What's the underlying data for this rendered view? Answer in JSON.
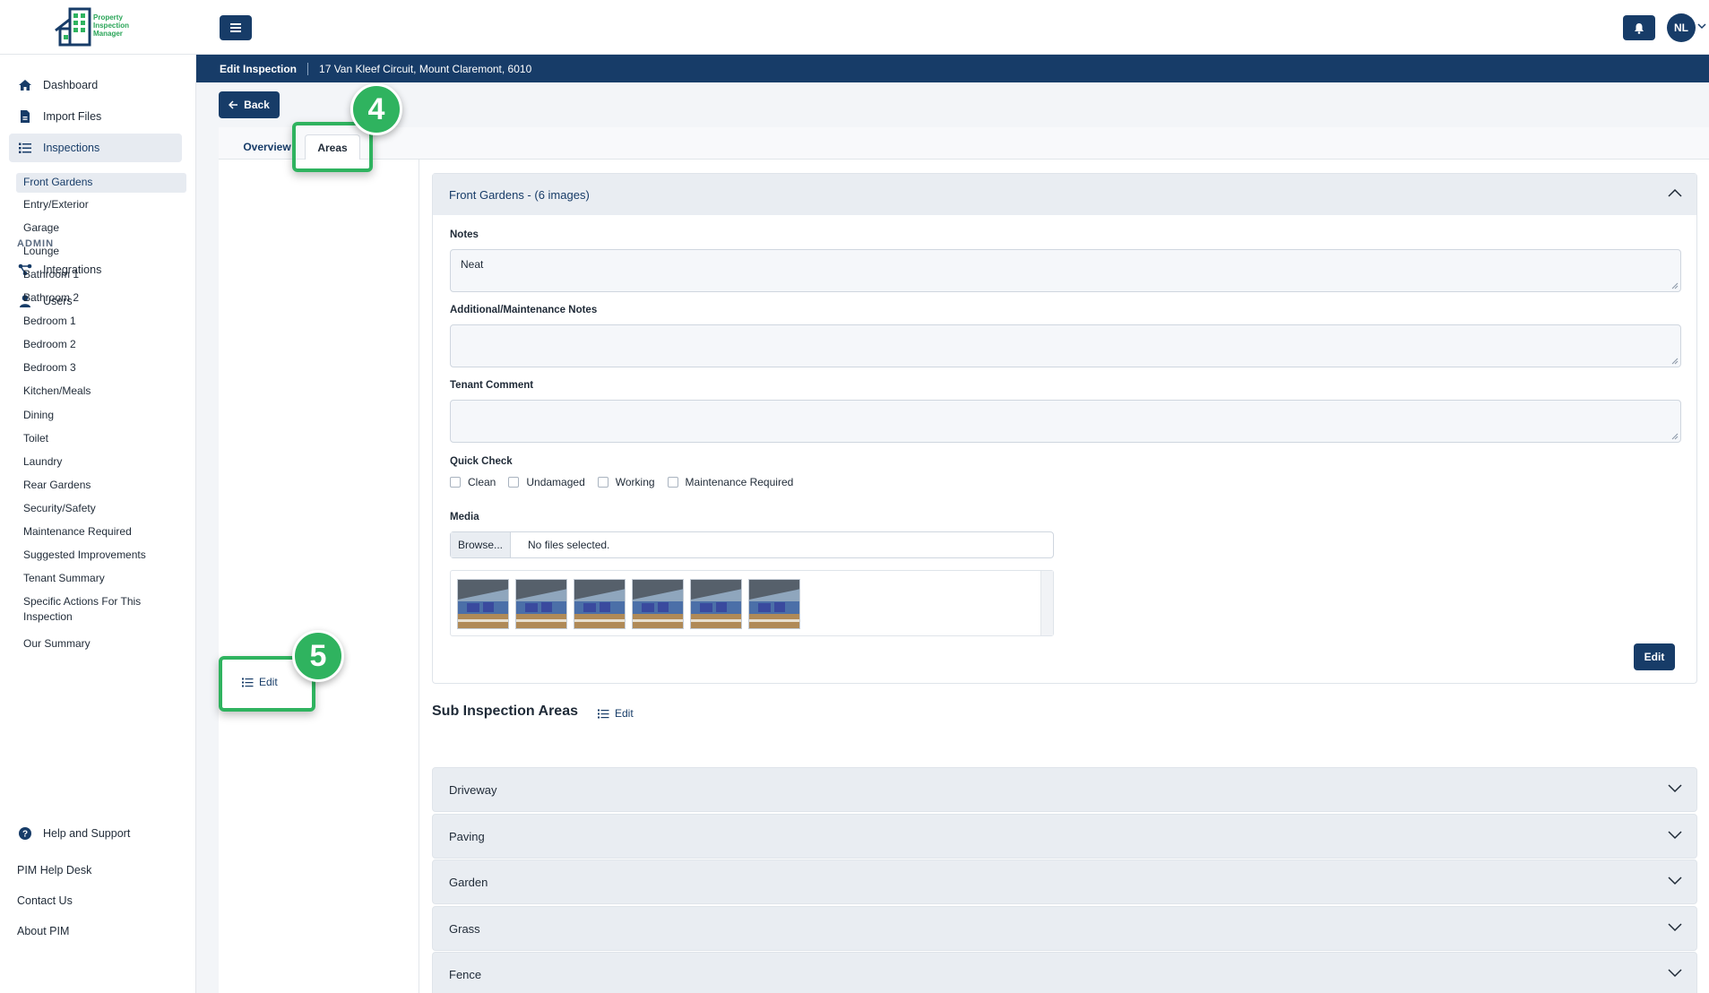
{
  "brand": {
    "name_line1": "Property",
    "name_line2": "Inspection",
    "name_line3": "Manager"
  },
  "user": {
    "initials": "NL"
  },
  "sidebar": {
    "items": [
      {
        "label": "Dashboard",
        "icon": "home-icon"
      },
      {
        "label": "Import Files",
        "icon": "file-icon"
      },
      {
        "label": "Inspections",
        "icon": "list-icon",
        "active": true
      }
    ],
    "admin_label": "ADMIN",
    "admin_items": [
      {
        "label": "Integrations",
        "icon": "integrations-icon"
      },
      {
        "label": "Users",
        "icon": "user-icon"
      }
    ],
    "footer": {
      "help": "Help and Support",
      "helpdesk": "PIM Help Desk",
      "contact": "Contact Us",
      "about": "About PIM"
    }
  },
  "header": {
    "title": "Edit Inspection",
    "address": "17 Van Kleef Circuit, Mount Claremont, 6010"
  },
  "back_label": "Back",
  "tabs": {
    "overview": "Overview",
    "areas": "Areas"
  },
  "badges": {
    "areas_tab": "4",
    "areas_edit": "5"
  },
  "areas": [
    "Front Gardens",
    "Entry/Exterior",
    "Garage",
    "Lounge",
    "Bathroom 1",
    "Bathroom 2",
    "Bedroom 1",
    "Bedroom 2",
    "Bedroom 3",
    "Kitchen/Meals",
    "Dining",
    "Toilet",
    "Laundry",
    "Rear Gardens",
    "Security/Safety",
    "Maintenance Required",
    "Suggested Improvements",
    "Tenant Summary",
    "Specific Actions For This Inspection",
    "Our Summary"
  ],
  "areas_edit_label": "Edit",
  "card": {
    "title": "Front Gardens - (6 images)",
    "notes_label": "Notes",
    "notes_value": "Neat",
    "additional_label": "Additional/Maintenance Notes",
    "additional_value": "",
    "tenant_label": "Tenant Comment",
    "tenant_value": "",
    "quick_check_label": "Quick Check",
    "checks": [
      "Clean",
      "Undamaged",
      "Working",
      "Maintenance Required"
    ],
    "media_label": "Media",
    "browse_label": "Browse...",
    "file_status": "No files selected.",
    "image_count": 6,
    "edit_label": "Edit"
  },
  "sub_areas": {
    "title": "Sub Inspection Areas",
    "edit_label": "Edit",
    "items": [
      "Driveway",
      "Paving",
      "Garden",
      "Grass",
      "Fence"
    ]
  },
  "colors": {
    "primary": "#173c68",
    "highlight": "#2fb35f",
    "active_bg": "#e7ebf1"
  }
}
